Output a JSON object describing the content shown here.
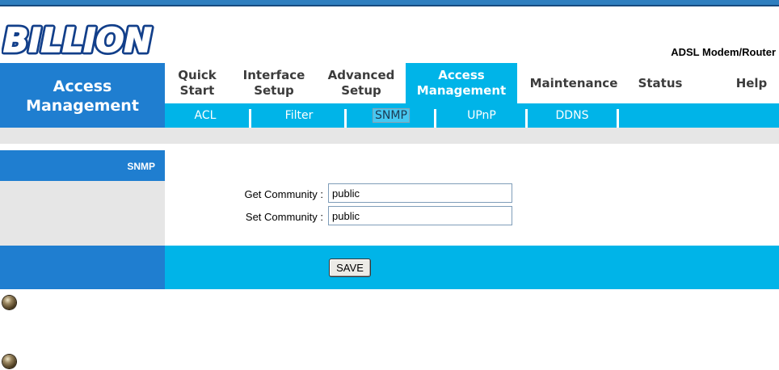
{
  "brand": {
    "logo_text": "BILLION",
    "product": "ADSL Modem/Router"
  },
  "sidebar": {
    "title_line1": "Access",
    "title_line2": "Management"
  },
  "main_nav": [
    {
      "line1": "Quick",
      "line2": "Start"
    },
    {
      "line1": "Interface",
      "line2": "Setup"
    },
    {
      "line1": "Advanced",
      "line2": "Setup"
    },
    {
      "line1": "Access",
      "line2": "Management"
    },
    {
      "line1": "Maintenance",
      "line2": ""
    },
    {
      "line1": "Status",
      "line2": ""
    },
    {
      "line1": "Help",
      "line2": ""
    }
  ],
  "active_main": "Access Management",
  "sub_nav": [
    "ACL",
    "Filter",
    "SNMP",
    "UPnP",
    "DDNS"
  ],
  "active_sub": "SNMP",
  "section": {
    "label": "SNMP",
    "get_community_label": "Get Community :",
    "get_community_value": "public",
    "set_community_label": "Set Community :",
    "set_community_value": "public"
  },
  "actions": {
    "save_label": "SAVE"
  },
  "colors": {
    "primary_blue": "#1f7ed0",
    "accent_cyan": "#00b4e8",
    "band_gray": "#e6e6e6"
  }
}
